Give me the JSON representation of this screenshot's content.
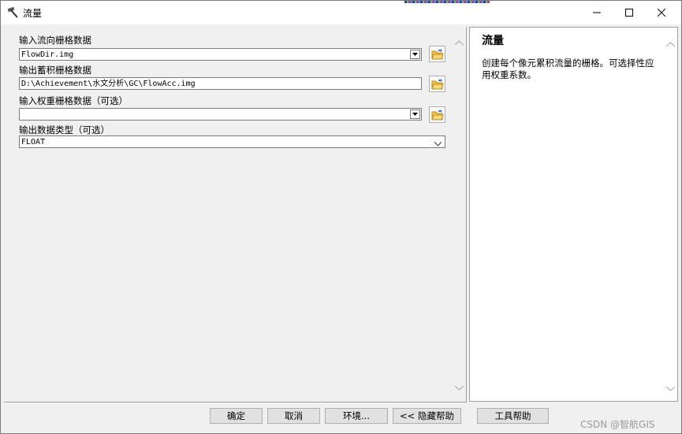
{
  "window": {
    "title": "流量",
    "icon": "hammer-icon"
  },
  "form": {
    "input_flow_dir": {
      "label": "输入流向栅格数据",
      "value": "FlowDir.img"
    },
    "output_accum": {
      "label": "输出蓄积栅格数据",
      "value": "D:\\Achievement\\水文分析\\GC\\FlowAcc.img"
    },
    "input_weight": {
      "label": "输入权重栅格数据（可选）",
      "value": ""
    },
    "output_type": {
      "label": "输出数据类型（可选）",
      "value": "FLOAT"
    }
  },
  "help": {
    "title": "流量",
    "text": "创建每个像元累积流量的栅格。可选择性应用权重系数。"
  },
  "buttons": {
    "ok": "确定",
    "cancel": "取消",
    "environments": "环境...",
    "hide_help": "<< 隐藏帮助",
    "tool_help": "工具帮助"
  },
  "watermark": "CSDN @智航GIS"
}
